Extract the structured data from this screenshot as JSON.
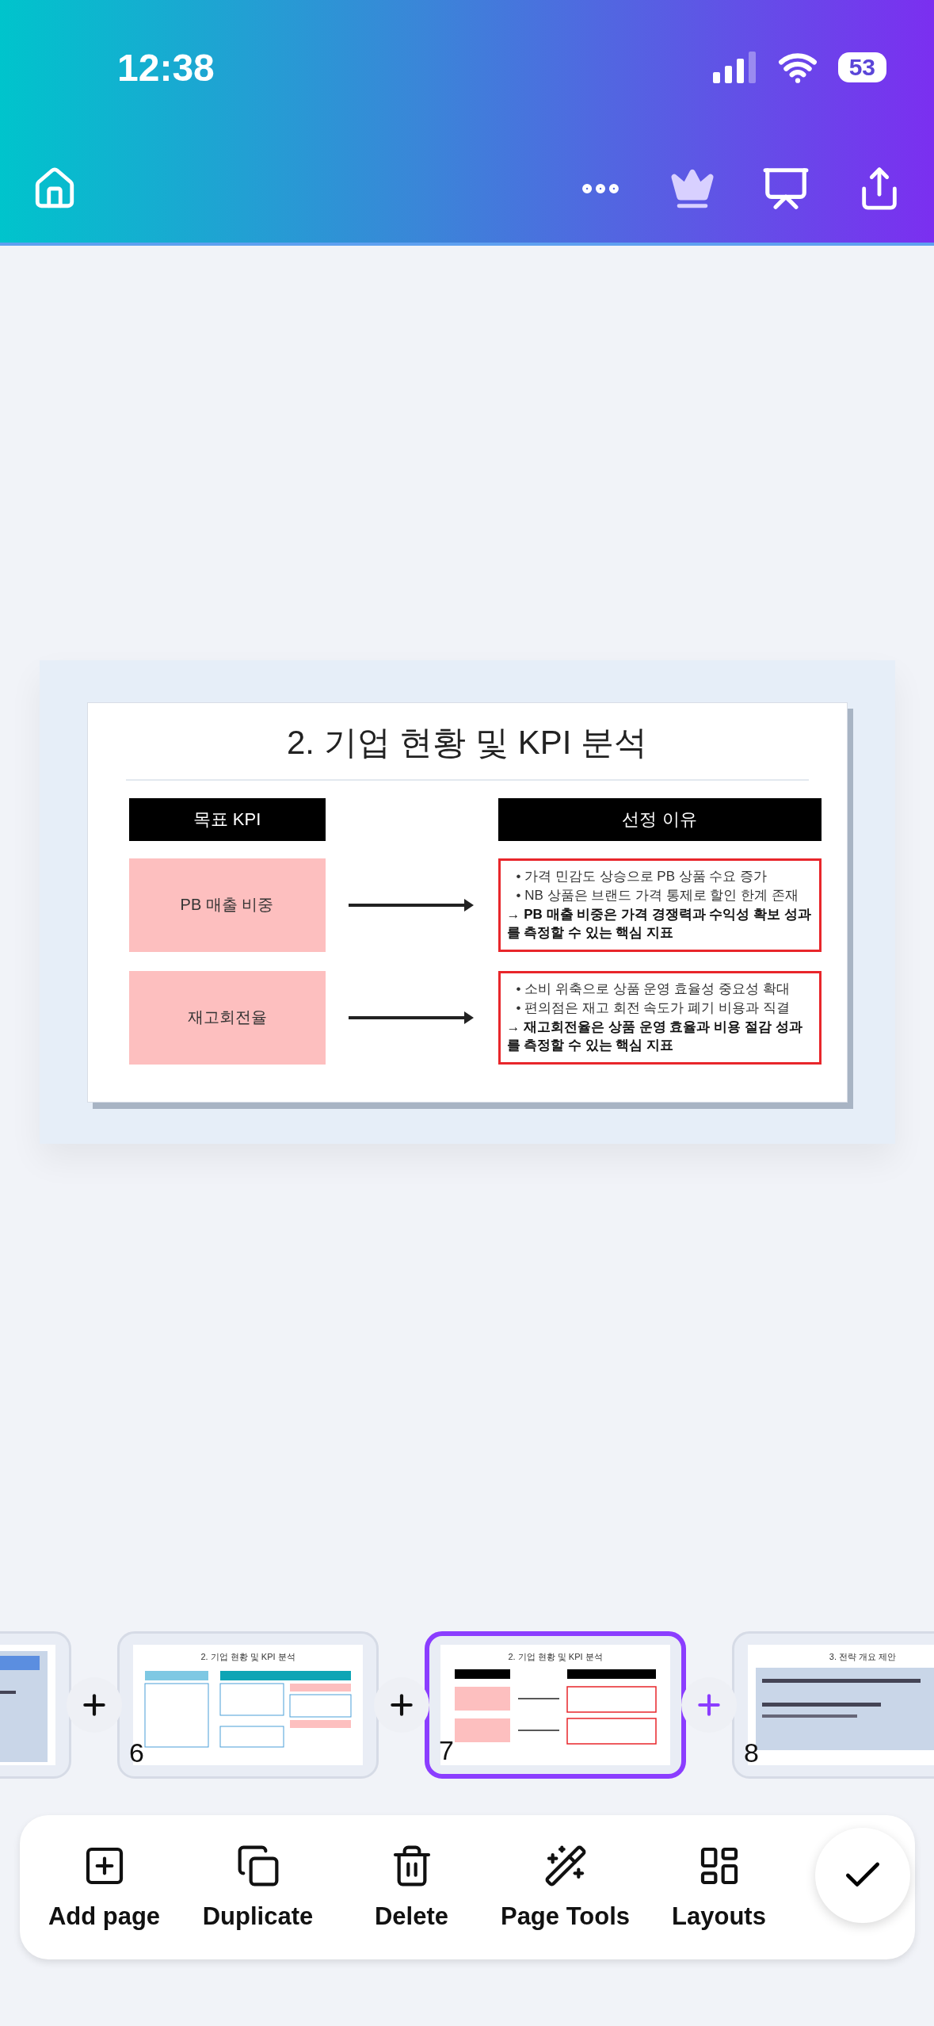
{
  "status_bar": {
    "time": "12:38",
    "battery": "53"
  },
  "slide": {
    "title": "2. 기업 현황 및 KPI 분석",
    "headers": [
      "목표 KPI",
      "선정 이유"
    ],
    "rows": [
      {
        "kpi": "PB 매출 비중",
        "bullets": [
          "• 가격 민감도 상승으로 PB 상품 수요 증가",
          "• NB 상품은 브랜드 가격 통제로 할인 한계 존재"
        ],
        "conclusion": "→ PB 매출 비중은 가격 경쟁력과 수익성 확보 성과를 측정할 수 있는 핵심 지표"
      },
      {
        "kpi": "재고회전율",
        "bullets": [
          "• 소비 위축으로 상품 운영 효율성 중요성 확대",
          "• 편의점은 재고 회전 속도가 폐기 비용과 직결"
        ],
        "conclusion": "→ 재고회전율은 상품 운영 효율과 비용 절감 성과를 측정할 수 있는 핵심 지표"
      }
    ]
  },
  "thumbnails": [
    {
      "kind": "partial",
      "selected": false
    },
    {
      "kind": "overview",
      "number": "6",
      "title": "2. 기업 현황 및 KPI 분석",
      "selected": false
    },
    {
      "kind": "kpi",
      "number": "7",
      "title": "2. 기업 현황 및 KPI 분석",
      "selected": true
    },
    {
      "kind": "strategy",
      "number": "8",
      "title": "3. 전략 개요 제안",
      "selected": false
    }
  ],
  "actions": [
    {
      "kind": "add",
      "label": "Add page"
    },
    {
      "kind": "duplicate",
      "label": "Duplicate"
    },
    {
      "kind": "delete",
      "label": "Delete"
    },
    {
      "kind": "tools",
      "label": "Page Tools"
    },
    {
      "kind": "layouts",
      "label": "Layouts"
    }
  ]
}
